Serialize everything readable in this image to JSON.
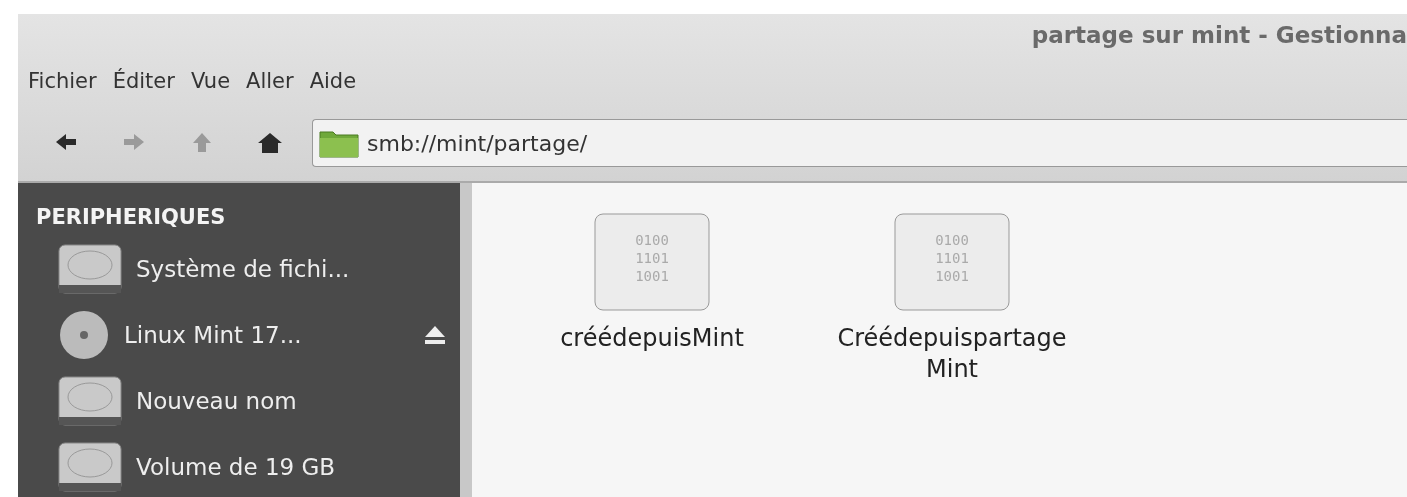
{
  "window": {
    "title": "partage sur mint - Gestionna"
  },
  "menu": [
    "Fichier",
    "Éditer",
    "Vue",
    "Aller",
    "Aide"
  ],
  "toolbar": [
    {
      "kind": "back",
      "disabled": false
    },
    {
      "kind": "forward",
      "disabled": true
    },
    {
      "kind": "up",
      "disabled": true
    },
    {
      "kind": "home",
      "disabled": false
    }
  ],
  "location": {
    "value": "smb://mint/partage/"
  },
  "sidebar": {
    "heading": "PERIPHERIQUES",
    "items": [
      {
        "label": "Système de fichi...",
        "kind": "disk",
        "eject": false
      },
      {
        "label": "Linux Mint 17...",
        "kind": "optical",
        "eject": true
      },
      {
        "label": "Nouveau nom",
        "kind": "disk",
        "eject": false
      },
      {
        "label": "Volume de 19 GB",
        "kind": "disk",
        "eject": false
      }
    ]
  },
  "files": [
    {
      "name": "créédepuisMint",
      "icon_text": [
        "0100",
        "1101",
        "1001"
      ]
    },
    {
      "name": "CréédepuispartageMint",
      "icon_text": [
        "0100",
        "1101",
        "1001"
      ]
    }
  ]
}
